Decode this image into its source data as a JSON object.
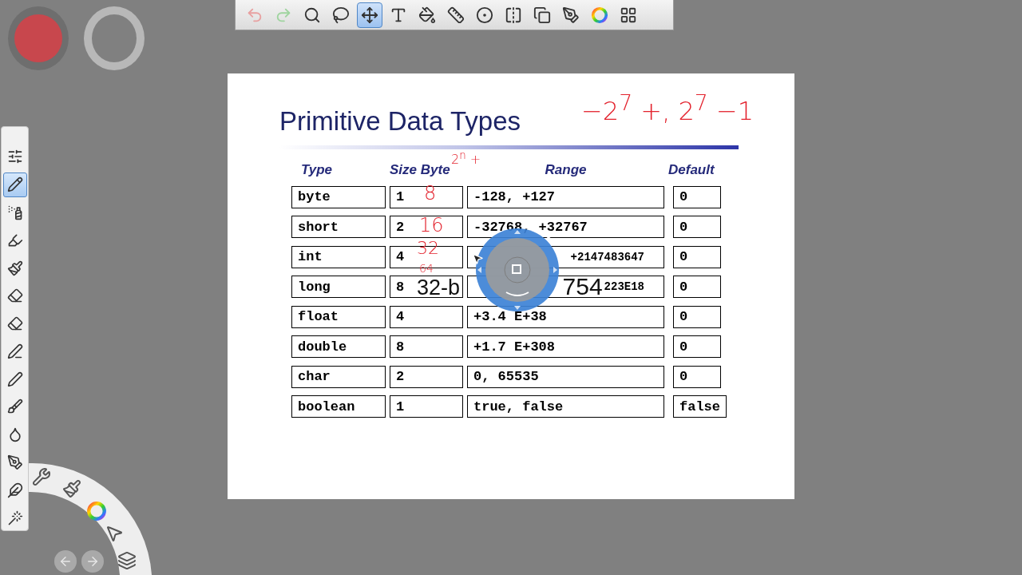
{
  "toolbar": {
    "tools": [
      {
        "kind": "undo",
        "selected": false
      },
      {
        "kind": "redo",
        "selected": false
      },
      {
        "kind": "zoom",
        "selected": false
      },
      {
        "kind": "lasso",
        "selected": false
      },
      {
        "kind": "move",
        "selected": true
      },
      {
        "kind": "text",
        "selected": false
      },
      {
        "kind": "fill",
        "selected": false
      },
      {
        "kind": "ruler",
        "selected": false
      },
      {
        "kind": "ellipse",
        "selected": false
      },
      {
        "kind": "symmetry",
        "selected": false
      },
      {
        "kind": "layers",
        "selected": false
      },
      {
        "kind": "brushes",
        "selected": false
      },
      {
        "kind": "color",
        "selected": false
      },
      {
        "kind": "palette",
        "selected": false
      }
    ]
  },
  "brush_pucks": [
    {
      "kind": "color",
      "color": "#c8474d"
    },
    {
      "kind": "size"
    }
  ],
  "tool_palette": {
    "tools": [
      {
        "kind": "settings",
        "selected": false
      },
      {
        "kind": "pencil",
        "selected": true
      },
      {
        "kind": "airbrush",
        "selected": false
      },
      {
        "kind": "marker",
        "selected": false
      },
      {
        "kind": "paintbrush",
        "selected": false
      },
      {
        "kind": "eraser",
        "selected": false
      },
      {
        "kind": "soft-eraser",
        "selected": false
      },
      {
        "kind": "felt-pen",
        "selected": false
      },
      {
        "kind": "chisel-pen",
        "selected": false
      },
      {
        "kind": "brush",
        "selected": false
      },
      {
        "kind": "smudge",
        "selected": false
      },
      {
        "kind": "ballpoint",
        "selected": false
      },
      {
        "kind": "ink-pen",
        "selected": false
      },
      {
        "kind": "wedge",
        "selected": false
      }
    ]
  },
  "slide": {
    "title": "Primitive Data Types",
    "columns": [
      "Type",
      "Size Byte",
      "Range",
      "Default"
    ],
    "rows": [
      {
        "type": "byte",
        "size": "1",
        "range": "-128, +127",
        "range_covered": false,
        "default": "0"
      },
      {
        "type": "short",
        "size": "2",
        "range": "-32768, +32767",
        "range_covered": false,
        "default": "0"
      },
      {
        "type": "int",
        "size": "4",
        "range": "+2147483647",
        "range_covered": true,
        "default": "0"
      },
      {
        "type": "long",
        "size": "8",
        "caption": "754",
        "range": "223E18",
        "range_covered": true,
        "default": "0"
      },
      {
        "type": "float",
        "size": "4",
        "range": "+3.4 E+38",
        "range_covered": false,
        "default": "0"
      },
      {
        "type": "double",
        "size": "8",
        "range": "+1.7 E+308",
        "range_covered": false,
        "default": "0"
      },
      {
        "type": "char",
        "size": "2",
        "range": "0, 65535",
        "range_covered": false,
        "default": "0"
      },
      {
        "type": "boolean",
        "size": "1",
        "range": "true, false",
        "range_covered": false,
        "default": "false"
      }
    ],
    "ink_notes": [
      "−2$^{7}$ +, 2$^{7}$ −1",
      "2$^{n}$ +",
      "8",
      "16",
      "32",
      "64"
    ],
    "overlay_caption": "32-b"
  },
  "radial_menu": {
    "items": [
      {
        "kind": "tools"
      },
      {
        "kind": "brush"
      },
      {
        "kind": "color"
      },
      {
        "kind": "select"
      },
      {
        "kind": "layers"
      }
    ],
    "nav": [
      {
        "kind": "back"
      },
      {
        "kind": "forward"
      }
    ]
  }
}
